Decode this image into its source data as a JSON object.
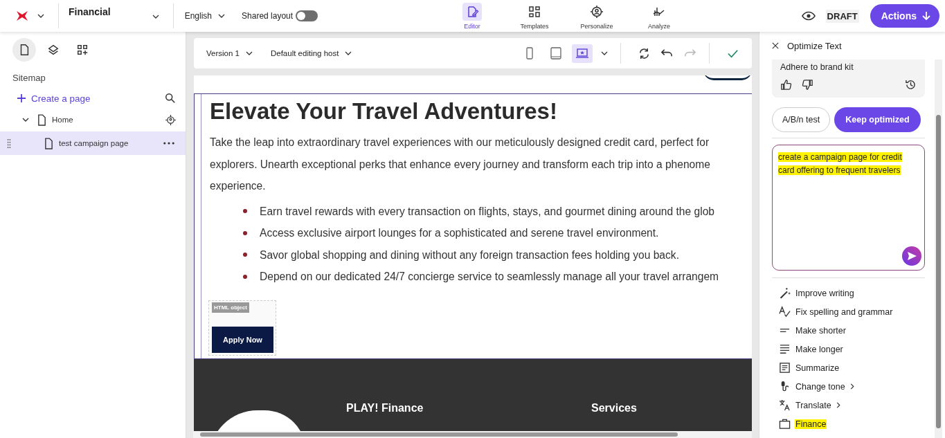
{
  "header": {
    "site": "Financial",
    "language": "English",
    "shared_layout": {
      "label": "Shared layout",
      "on": false
    },
    "nav": [
      {
        "label": "Editor",
        "selected": true
      },
      {
        "label": "Templates",
        "selected": false
      },
      {
        "label": "Personalize",
        "selected": false
      },
      {
        "label": "Analyze",
        "selected": false
      }
    ],
    "status": "DRAFT",
    "actions": "Actions"
  },
  "sidebar": {
    "tabs": [
      {
        "selected": true
      },
      {
        "selected": false
      },
      {
        "selected": false
      }
    ],
    "title": "Sitemap",
    "create": "Create a page",
    "tree": [
      {
        "label": "Home",
        "expanded": true,
        "selected": false,
        "children": [
          {
            "label": "test campaign page",
            "selected": true
          }
        ]
      }
    ]
  },
  "toolbar": {
    "version": "Version 1",
    "host": "Default editing host",
    "devices": [
      {
        "selected": false
      },
      {
        "selected": false
      },
      {
        "selected": true
      }
    ]
  },
  "page": {
    "heading": "Elevate Your Travel Adventures!",
    "paragraph_lines": [
      "Take the leap into extraordinary travel experiences with our meticulously designed credit card, perfect for",
      "explorers. Unearth exceptional perks that enhance every journey and transform each trip into a phenome",
      "experience."
    ],
    "bullets": [
      "Earn travel rewards with every transaction on flights, stays, and gourmet dining around the glob",
      "Access exclusive airport lounges for a sophisticated and serene travel environment.",
      "Savor global shopping and dining without any foreign transaction fees holding you back.",
      "Depend on our dedicated 24/7 concierge service to seamlessly manage all your travel arrangem"
    ],
    "html_object_label": "HTML object",
    "cta": "Apply Now",
    "footer": [
      "PLAY! Finance",
      "Services"
    ]
  },
  "panel": {
    "title": "Optimize Text",
    "result": "Adhere to brand kit",
    "buttons": [
      {
        "label": "A/B/n test",
        "kind": "outline"
      },
      {
        "label": "Keep optimized",
        "kind": "primary"
      }
    ],
    "prompt": {
      "lines": [
        "create a campaign page for credit",
        "card offering to frequent travelers"
      ],
      "highlighted": true
    },
    "menu": [
      {
        "label": "Improve writing",
        "submenu": false,
        "highlighted": false
      },
      {
        "label": "Fix spelling and grammar",
        "submenu": false,
        "highlighted": false
      },
      {
        "label": "Make shorter",
        "submenu": false,
        "highlighted": false
      },
      {
        "label": "Make longer",
        "submenu": false,
        "highlighted": false
      },
      {
        "label": "Summarize",
        "submenu": false,
        "highlighted": false
      },
      {
        "label": "Change tone",
        "submenu": true,
        "highlighted": false
      },
      {
        "label": "Translate",
        "submenu": true,
        "highlighted": false
      },
      {
        "label": "Finance",
        "submenu": false,
        "highlighted": true
      }
    ]
  }
}
